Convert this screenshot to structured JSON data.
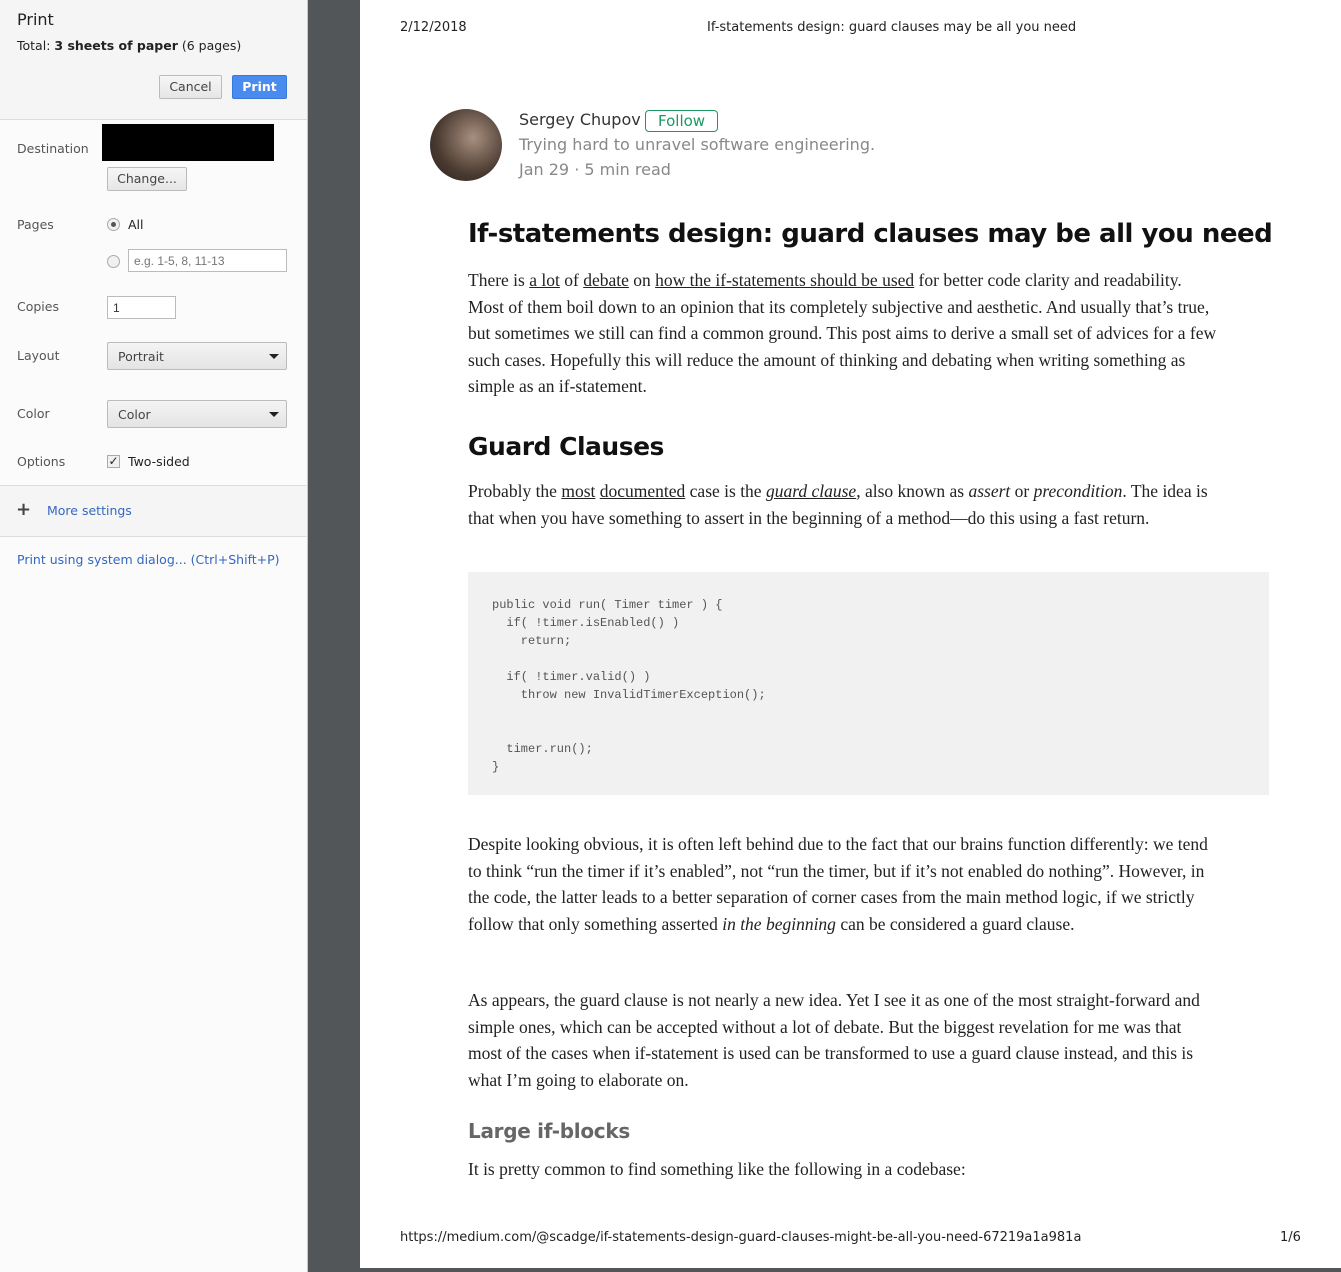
{
  "dialog": {
    "title": "Print",
    "total_prefix": "Total: ",
    "total_bold": "3 sheets of paper",
    "total_suffix": " (6 pages)",
    "cancel": "Cancel",
    "print": "Print",
    "destination_label": "Destination",
    "change": "Change...",
    "pages_label": "Pages",
    "pages_all": "All",
    "pages_placeholder": "e.g. 1-5, 8, 11-13",
    "copies_label": "Copies",
    "copies_value": "1",
    "layout_label": "Layout",
    "layout_value": "Portrait",
    "color_label": "Color",
    "color_value": "Color",
    "options_label": "Options",
    "two_sided": "Two-sided",
    "two_sided_checked": true,
    "more_settings": "More settings",
    "system_dialog": "Print using system dialog... (Ctrl+Shift+P)"
  },
  "page": {
    "date": "2/12/2018",
    "header_title": "If-statements design: guard clauses may be all you need",
    "url": "https://medium.com/@scadge/if-statements-design-guard-clauses-might-be-all-you-need-67219a1a981a",
    "page_num": "1/6",
    "author": {
      "name": "Sergey Chupov",
      "follow": "Follow",
      "bio": "Trying hard to unravel software engineering.",
      "meta": "Jan 29 · 5 min read"
    },
    "title": "If-statements design: guard clauses may be all you need",
    "p1": [
      {
        "t": "There is "
      },
      {
        "t": "a lot",
        "u": 1
      },
      {
        "t": " of "
      },
      {
        "t": "debate",
        "u": 1
      },
      {
        "t": " on "
      },
      {
        "t": "how the if-statements should be used",
        "u": 1
      },
      {
        "t": " for better code clarity and readability. Most of them boil down to an opinion that its completely subjective and aesthetic. And usually that’s true, but sometimes we still can find a common ground. This post aims to derive a small set of advices for a few such cases. Hopefully this will reduce the amount of thinking and debating when writing something as simple as an if-statement."
      }
    ],
    "h2": "Guard Clauses",
    "p2": [
      {
        "t": "Probably the "
      },
      {
        "t": "most",
        "u": 1
      },
      {
        "t": " "
      },
      {
        "t": "documented",
        "u": 1
      },
      {
        "t": " case is the "
      },
      {
        "t": "guard clause",
        "u": 1,
        "i": 1
      },
      {
        "t": ", also known as "
      },
      {
        "t": "assert",
        "i": 1
      },
      {
        "t": " or "
      },
      {
        "t": "precondition",
        "i": 1
      },
      {
        "t": ". The idea is that when you have something to assert in the beginning of a method—do this using a fast return."
      }
    ],
    "code": "public void run( Timer timer ) {\n  if( !timer.isEnabled() )\n    return;\n\n  if( !timer.valid() )\n    throw new InvalidTimerException();\n\n\n  timer.run();\n}",
    "p3": [
      {
        "t": "Despite looking obvious, it is often left behind due to the fact that our brains function differently: we tend to think “run the timer if it’s enabled”, not “run the timer, but if it’s not enabled do nothing”. However, in the code, the latter leads to a better separation of corner cases from the main method logic, if we strictly follow that only something asserted "
      },
      {
        "t": "in the beginning",
        "i": 1
      },
      {
        "t": " can be considered a guard clause."
      }
    ],
    "p4": [
      {
        "t": "As appears, the guard clause is not nearly a new idea. Yet I see it as one of the most straight-forward and simple ones, which can be accepted without a lot of debate. But the biggest revelation for me was that most of the cases when if-statement is used can be transformed to use a guard clause instead, and this is what I’m going to elaborate on."
      }
    ],
    "h3": "Large if-blocks",
    "p5": [
      {
        "t": "It is pretty common to find something like the following in a codebase:"
      }
    ]
  }
}
